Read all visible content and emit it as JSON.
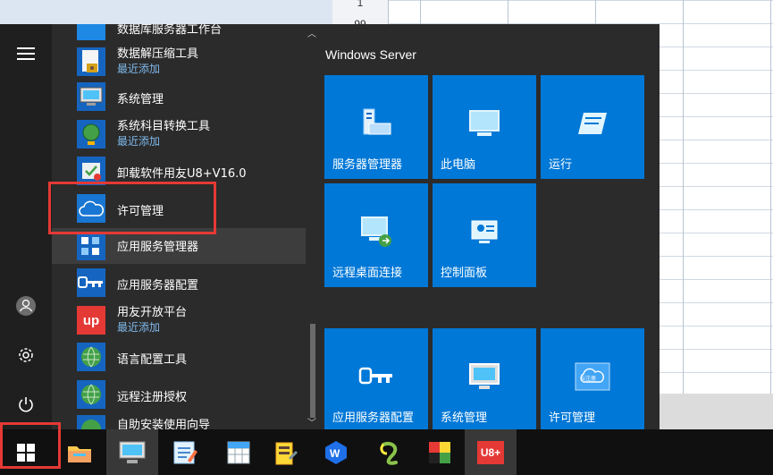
{
  "background_sheet": {
    "row_numbers": [
      "1",
      "99"
    ]
  },
  "start_menu": {
    "rail": {
      "menu": "☰",
      "user": "user-icon",
      "settings": "settings-icon",
      "power": "power-icon"
    },
    "apps": [
      {
        "label": "数据解压缩工具",
        "sub": "最近添加"
      },
      {
        "label": "系统管理",
        "sub": ""
      },
      {
        "label": "系统科目转换工具",
        "sub": "最近添加"
      },
      {
        "label": "卸载软件用友U8+V16.0",
        "sub": ""
      },
      {
        "label": "许可管理",
        "sub": ""
      },
      {
        "label": "应用服务管理器",
        "sub": ""
      },
      {
        "label": "应用服务器配置",
        "sub": ""
      },
      {
        "label": "用友开放平台",
        "sub": "最近添加"
      },
      {
        "label": "语言配置工具",
        "sub": ""
      },
      {
        "label": "远程注册授权",
        "sub": ""
      },
      {
        "label": "自助安装使用向导",
        "sub": ""
      }
    ],
    "app_top_partial": "数据库服务器工作台",
    "tiles_group": "Windows Server",
    "tiles": [
      {
        "label": "服务器管理器"
      },
      {
        "label": "此电脑"
      },
      {
        "label": "运行"
      },
      {
        "label": "远程桌面连接"
      },
      {
        "label": "控制面板"
      },
      {
        "label": "应用服务器配置"
      },
      {
        "label": "系统管理"
      },
      {
        "label": "许可管理"
      }
    ],
    "cloud_badge_text": "云注册",
    "up_badge_text": "up"
  },
  "taskbar": {
    "items": [
      "start-icon",
      "file-explorer-icon",
      "this-pc-icon",
      "form-editor-icon",
      "spreadsheet-icon",
      "server-tools-icon",
      "wps-icon",
      "snake-app-icon",
      "color-blocks-icon",
      "u8-icon"
    ],
    "u8_label": "U8+"
  },
  "colors": {
    "tile_blue": "#0078d7",
    "annotation_red": "#e53935",
    "menu_bg": "#2b2b2b"
  }
}
